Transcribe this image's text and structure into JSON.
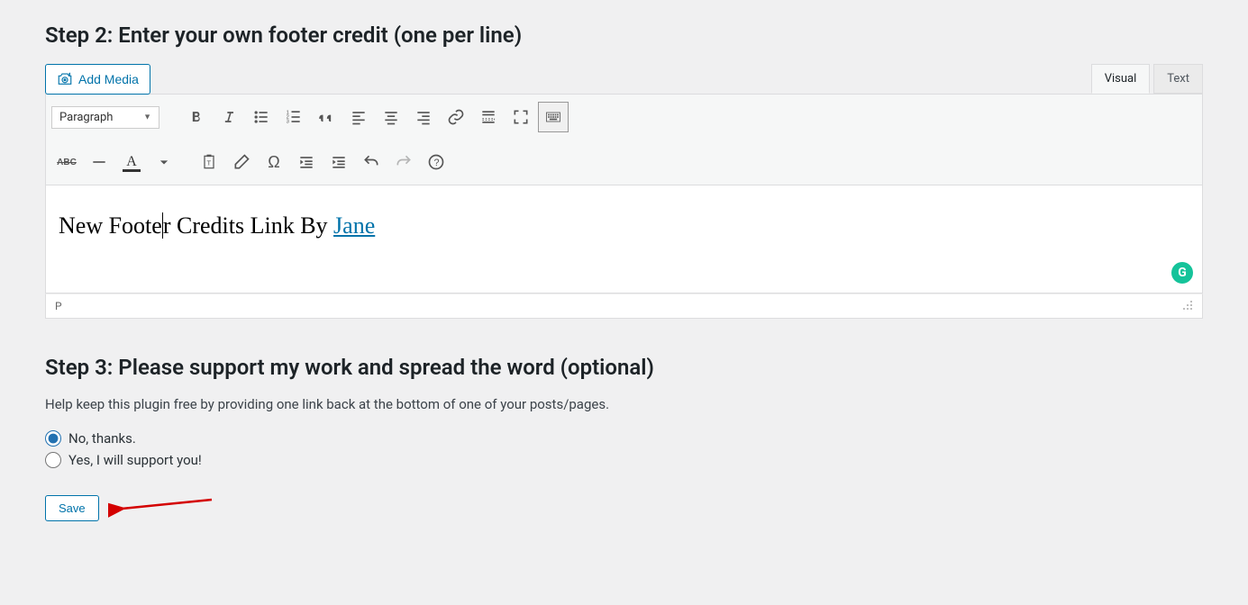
{
  "step2": {
    "heading": "Step 2: Enter your own footer credit (one per line)",
    "add_media_label": "Add Media",
    "tabs": {
      "visual": "Visual",
      "text": "Text"
    },
    "paragraph_label": "Paragraph",
    "editor_text_before": "New Foote",
    "editor_text_after": "r Credits Link By ",
    "editor_link_text": "Jane",
    "statusbar_path": "P",
    "grammarly_badge": "G"
  },
  "step3": {
    "heading": "Step 3: Please support my work and spread the word (optional)",
    "help_text": "Help keep this plugin free by providing one link back at the bottom of one of your posts/pages.",
    "radio_no": "No, thanks.",
    "radio_yes": "Yes, I will support you!"
  },
  "save_label": "Save",
  "text_color_char": "A"
}
